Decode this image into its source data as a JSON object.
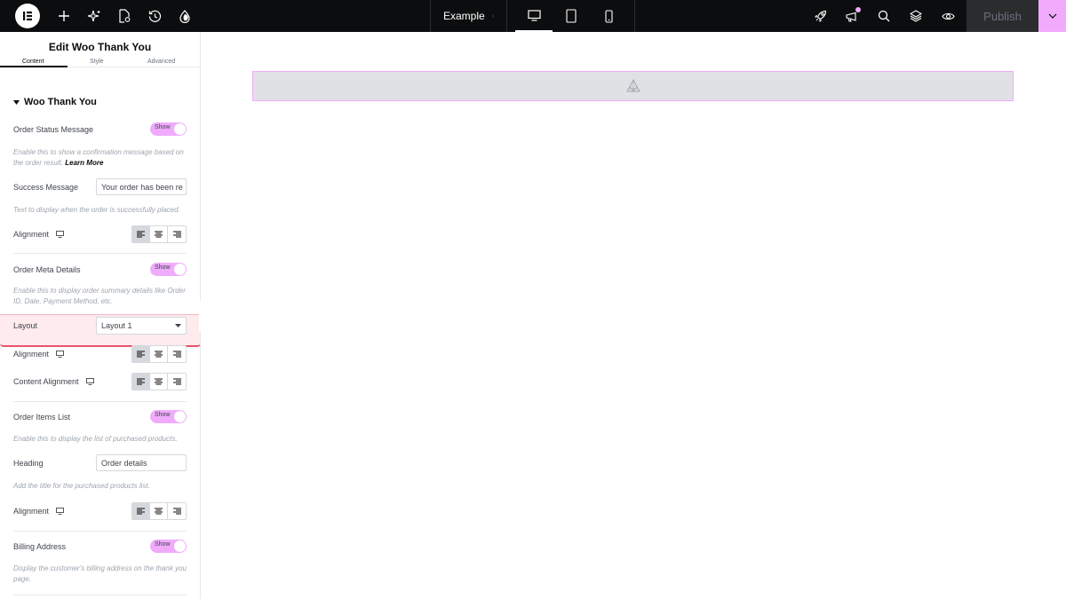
{
  "topbar": {
    "document_title": "Example",
    "publish_label": "Publish",
    "active_device": "desktop",
    "icons_left": [
      "elementor-logo-icon",
      "add-element-icon",
      "ai-sparkle-icon",
      "page-settings-icon",
      "history-icon",
      "theme-style-icon"
    ],
    "icons_right": [
      "rocket-icon",
      "announcements-icon",
      "search-icon",
      "layers-icon",
      "preview-eye-icon"
    ],
    "notification_dot_color": "#f0abfc"
  },
  "panel": {
    "title": "Edit Woo Thank You",
    "tabs": [
      {
        "label": "Content",
        "active": true
      },
      {
        "label": "Style",
        "active": false
      },
      {
        "label": "Advanced",
        "active": false
      }
    ],
    "section_title": "Woo Thank You",
    "order_status": {
      "label": "Order Status Message",
      "toggle": "Show",
      "description": "Enable this to show a confirmation message based on the order result.",
      "learn_more": "Learn More"
    },
    "success_message": {
      "label": "Success Message",
      "value": "Your order has been re",
      "description": "Text to display when the order is successfully placed."
    },
    "alignment_1": {
      "label": "Alignment",
      "active": "left"
    },
    "order_meta": {
      "label": "Order Meta Details",
      "toggle": "Show",
      "description": "Enable this to display order summary details like Order ID, Date, Payment Method, etc."
    },
    "layout": {
      "label": "Layout",
      "value": "Layout 1"
    },
    "alignment_2": {
      "label": "Alignment",
      "active": "left"
    },
    "content_alignment": {
      "label": "Content Alignment",
      "active": "left"
    },
    "order_items": {
      "label": "Order Items List",
      "toggle": "Show",
      "description": "Enable this to display the list of purchased products."
    },
    "heading": {
      "label": "Heading",
      "value": "Order details",
      "description": "Add the title for the purchased products list."
    },
    "alignment_3": {
      "label": "Alignment",
      "active": "left"
    },
    "billing": {
      "label": "Billing Address",
      "toggle": "Show",
      "description": "Display the customer's billing address on the thank you page."
    }
  },
  "colors": {
    "accent": "#f0abfc",
    "highlight_border": "#e9546b",
    "topbar_bg": "#0c0d0e"
  }
}
